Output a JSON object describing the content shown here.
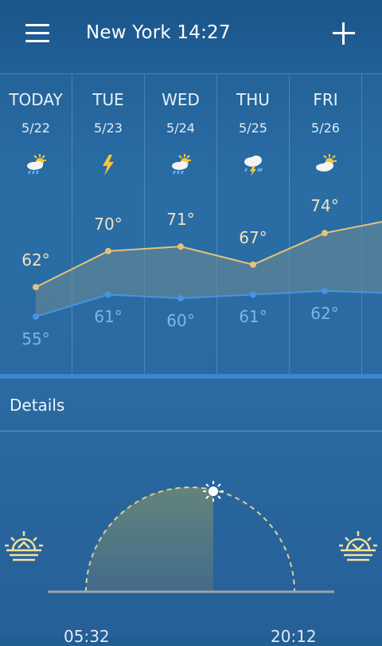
{
  "header": {
    "title": "New York 14:27"
  },
  "forecast": {
    "days": [
      {
        "day": "TODAY",
        "date": "5/22",
        "icon": "partly-cloudy-rain-icon",
        "high": "62°",
        "low": "55°",
        "high_value": 62,
        "low_value": 55
      },
      {
        "day": "TUE",
        "date": "5/23",
        "icon": "lightning-icon",
        "high": "70°",
        "low": "61°",
        "high_value": 70,
        "low_value": 61
      },
      {
        "day": "WED",
        "date": "5/24",
        "icon": "partly-cloudy-rain-icon",
        "high": "71°",
        "low": "60°",
        "high_value": 71,
        "low_value": 60
      },
      {
        "day": "THU",
        "date": "5/25",
        "icon": "thunderstorm-rain-icon",
        "high": "67°",
        "low": "61°",
        "high_value": 67,
        "low_value": 61
      },
      {
        "day": "FRI",
        "date": "5/26",
        "icon": "partly-cloudy-icon",
        "high": "74°",
        "low": "62°",
        "high_value": 74,
        "low_value": 62
      }
    ]
  },
  "details": {
    "title": "Details",
    "sunrise": "05:32",
    "sunset": "20:12",
    "sunrise_icon": "sunrise-icon",
    "sunset_icon": "sunset-icon"
  },
  "colors": {
    "high_line": "#e5c27c",
    "low_line": "#4b92e0",
    "accent_bar": "#3d86cc"
  }
}
